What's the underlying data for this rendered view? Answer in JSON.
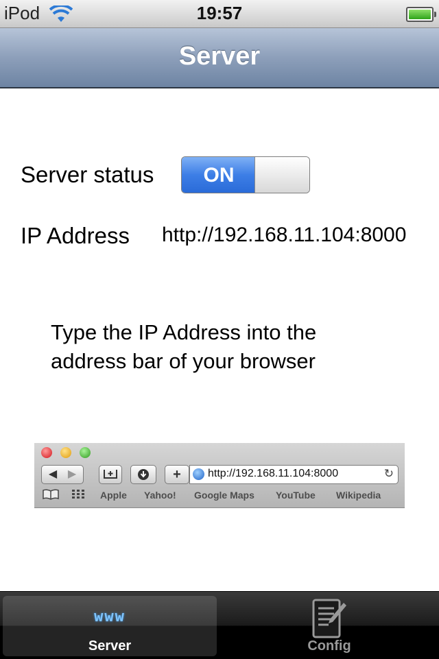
{
  "status_bar": {
    "carrier": "iPod",
    "time": "19:57",
    "wifi_icon": "wifi-icon",
    "battery_icon": "battery-icon",
    "battery_level": 1.0
  },
  "nav": {
    "title": "Server"
  },
  "server_status": {
    "label": "Server status",
    "toggle_text": "ON",
    "toggle_state": true,
    "accent_color": "#3d7ee6"
  },
  "ip": {
    "label": "IP Address",
    "value": "http://192.168.11.104:8000"
  },
  "instruction": "Type the IP Address into the address bar of your browser",
  "browser_illustration": {
    "address": "http://192.168.11.104:8000",
    "bookmarks": [
      "Apple",
      "Yahoo!",
      "Google Maps",
      "YouTube",
      "Wikipedia"
    ],
    "buttons": {
      "back": "◀",
      "forward": "▶",
      "add": "+"
    }
  },
  "tabs": [
    {
      "label": "Server",
      "icon_text": "www",
      "icon": "www-icon",
      "selected": true
    },
    {
      "label": "Config",
      "icon": "notepad-pencil-icon",
      "selected": false
    }
  ]
}
